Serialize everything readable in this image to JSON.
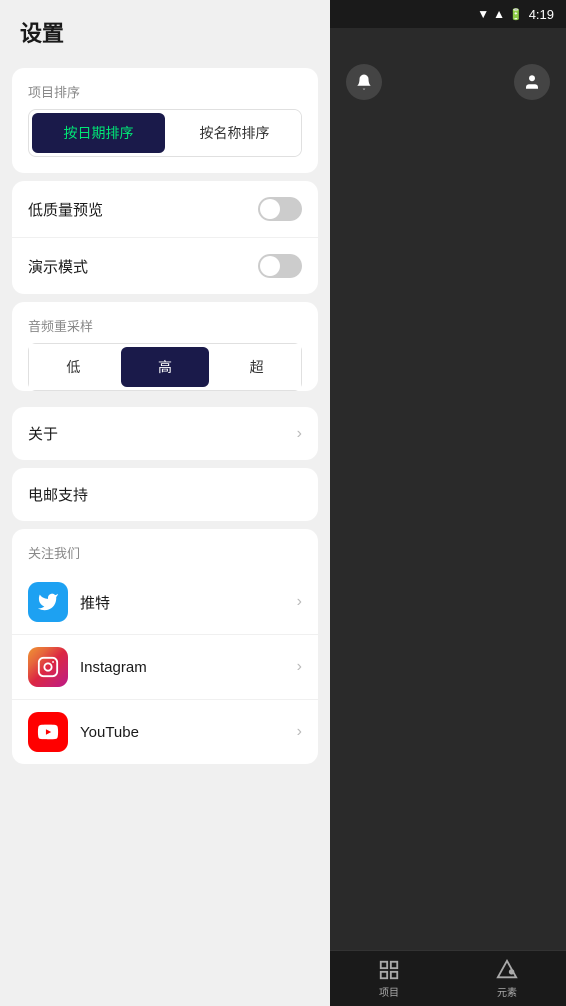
{
  "statusBar": {
    "time": "4:19"
  },
  "pageTitle": "设置",
  "sortSection": {
    "label": "项目排序",
    "btn1": "按日期排序",
    "btn2": "按名称排序",
    "active": 0
  },
  "toggleSection": {
    "lowQualityLabel": "低质量预览",
    "demoModeLabel": "演示模式",
    "lowQualityOn": false,
    "demoModeOn": false
  },
  "audioSection": {
    "label": "音频重采样",
    "options": [
      "低",
      "高",
      "超"
    ],
    "active": 1
  },
  "aboutItem": {
    "label": "关于"
  },
  "emailItem": {
    "label": "电邮支持"
  },
  "followSection": {
    "label": "关注我们",
    "items": [
      {
        "name": "推特",
        "platform": "twitter"
      },
      {
        "name": "Instagram",
        "platform": "instagram"
      },
      {
        "name": "YouTube",
        "platform": "youtube"
      }
    ]
  },
  "bottomNav": {
    "item1": "项目",
    "item2": "元素"
  }
}
